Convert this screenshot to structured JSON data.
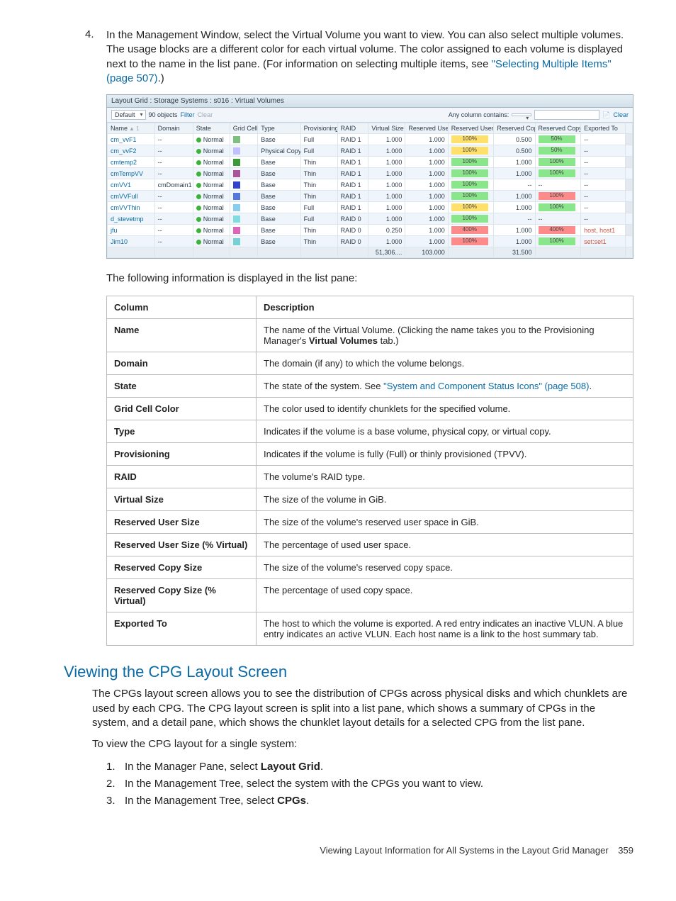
{
  "step4": {
    "number": "4.",
    "text_before_link": "In the Management Window, select the Virtual Volume you want to view. You can also select multiple volumes. The usage blocks are a different color for each virtual volume. The color assigned to each volume is displayed next to the name in the list pane. (For information on selecting multiple items, see ",
    "link_text": "\"Selecting Multiple Items\" (page 507)",
    "text_after_link": ".)"
  },
  "grid": {
    "title": "Layout Grid : Storage Systems : s016 : Virtual Volumes",
    "toolbar": {
      "view": "Default",
      "count_label": "90 objects",
      "filter_label": "Filter",
      "clear_left": "Clear",
      "any_col": "Any column contains:",
      "clear_right": "Clear"
    },
    "headers": [
      "Name",
      "Domain",
      "State",
      "Grid Cell Color",
      "Type",
      "Provisioning",
      "RAID",
      "Virtual Size (GiB)",
      "Reserved User Size (GiB)",
      "Reserved User Size (% Virtual)",
      "Reserved Copy Size (GiB)",
      "Reserved Copy Size (% Virtual)",
      "Exported To"
    ],
    "rows": [
      {
        "name": "cm_vvF1",
        "domain": "--",
        "state": "Normal",
        "swatch": "#7fbf7f",
        "type": "Base",
        "prov": "Full",
        "raid": "RAID 1",
        "vsize": "1.000",
        "rus": "1.000",
        "rupct": {
          "label": "100%",
          "color": "yellow"
        },
        "rcs": "0.500",
        "rcpct": {
          "label": "50%",
          "color": "green"
        },
        "exp": "--",
        "alt": false
      },
      {
        "name": "cm_vvF2",
        "domain": "--",
        "state": "Normal",
        "swatch": "#c0c0ff",
        "type": "Physical Copy",
        "prov": "Full",
        "raid": "RAID 1",
        "vsize": "1.000",
        "rus": "1.000",
        "rupct": {
          "label": "100%",
          "color": "yellow"
        },
        "rcs": "0.500",
        "rcpct": {
          "label": "50%",
          "color": "green"
        },
        "exp": "--",
        "alt": true
      },
      {
        "name": "cmtemp2",
        "domain": "--",
        "state": "Normal",
        "swatch": "#3b9b3b",
        "type": "Base",
        "prov": "Thin",
        "raid": "RAID 1",
        "vsize": "1.000",
        "rus": "1.000",
        "rupct": {
          "label": "100%",
          "color": "green"
        },
        "rcs": "1.000",
        "rcpct": {
          "label": "100%",
          "color": "green"
        },
        "exp": "--",
        "alt": false
      },
      {
        "name": "cmTempVV",
        "domain": "--",
        "state": "Normal",
        "swatch": "#aa5599",
        "type": "Base",
        "prov": "Thin",
        "raid": "RAID 1",
        "vsize": "1.000",
        "rus": "1.000",
        "rupct": {
          "label": "100%",
          "color": "green"
        },
        "rcs": "1.000",
        "rcpct": {
          "label": "100%",
          "color": "green"
        },
        "exp": "--",
        "alt": true
      },
      {
        "name": "cmVV1",
        "domain": "cmDomain1",
        "state": "Normal",
        "swatch": "#3344cc",
        "type": "Base",
        "prov": "Thin",
        "raid": "RAID 1",
        "vsize": "1.000",
        "rus": "1.000",
        "rupct": {
          "label": "100%",
          "color": "green"
        },
        "rcs": "--",
        "rcpct": {
          "label": "--",
          "color": "none"
        },
        "exp": "--",
        "alt": false
      },
      {
        "name": "cmVVFull",
        "domain": "--",
        "state": "Normal",
        "swatch": "#5577dd",
        "type": "Base",
        "prov": "Thin",
        "raid": "RAID 1",
        "vsize": "1.000",
        "rus": "1.000",
        "rupct": {
          "label": "100%",
          "color": "green"
        },
        "rcs": "1.000",
        "rcpct": {
          "label": "100%",
          "color": "red"
        },
        "exp": "--",
        "alt": true
      },
      {
        "name": "cmVVThin",
        "domain": "--",
        "state": "Normal",
        "swatch": "#88ccee",
        "type": "Base",
        "prov": "Full",
        "raid": "RAID 1",
        "vsize": "1.000",
        "rus": "1.000",
        "rupct": {
          "label": "100%",
          "color": "yellow"
        },
        "rcs": "1.000",
        "rcpct": {
          "label": "100%",
          "color": "green"
        },
        "exp": "--",
        "alt": false
      },
      {
        "name": "d_stevetmp",
        "domain": "--",
        "state": "Normal",
        "swatch": "#7fdde0",
        "type": "Base",
        "prov": "Full",
        "raid": "RAID 0",
        "vsize": "1.000",
        "rus": "1.000",
        "rupct": {
          "label": "100%",
          "color": "green"
        },
        "rcs": "--",
        "rcpct": {
          "label": "--",
          "color": "none"
        },
        "exp": "--",
        "alt": true
      },
      {
        "name": "jfu",
        "domain": "--",
        "state": "Normal",
        "swatch": "#dd66bb",
        "type": "Base",
        "prov": "Thin",
        "raid": "RAID 0",
        "vsize": "0.250",
        "rus": "1.000",
        "rupct": {
          "label": "400%",
          "color": "red"
        },
        "rcs": "1.000",
        "rcpct": {
          "label": "400%",
          "color": "red"
        },
        "exp": "host, host1",
        "alt": false
      },
      {
        "name": "Jim10",
        "domain": "--",
        "state": "Normal",
        "swatch": "#77d1d4",
        "type": "Base",
        "prov": "Thin",
        "raid": "RAID 0",
        "vsize": "1.000",
        "rus": "1.000",
        "rupct": {
          "label": "100%",
          "color": "red"
        },
        "rcs": "1.000",
        "rcpct": {
          "label": "100%",
          "color": "green"
        },
        "exp": "set:set1",
        "alt": true
      }
    ],
    "footer": {
      "vsize": "51,306....",
      "rus": "103.000",
      "rcs": "31.500"
    }
  },
  "para_after": "The following information is displayed in the list pane:",
  "desc_table": {
    "head": [
      "Column",
      "Description"
    ],
    "rows": [
      {
        "c": "Name",
        "plain_before": "The name of the Virtual Volume. (Clicking the name takes you to the Provisioning Manager's ",
        "bold": "Virtual Volumes",
        "plain_after": " tab.)"
      },
      {
        "c": "Domain",
        "d": "The domain (if any) to which the volume belongs."
      },
      {
        "c": "State",
        "plain_before": "The state of the system. See ",
        "link": "\"System and Component Status Icons\" (page 508)",
        "plain_after": "."
      },
      {
        "c": "Grid Cell Color",
        "d": "The color used to identify chunklets for the specified volume."
      },
      {
        "c": "Type",
        "d": "Indicates if the volume is a base volume, physical copy, or virtual copy."
      },
      {
        "c": "Provisioning",
        "d": "Indicates if the volume is fully (Full) or thinly provisioned (TPVV)."
      },
      {
        "c": "RAID",
        "d": "The volume's RAID type."
      },
      {
        "c": "Virtual Size",
        "d": "The size of the volume in GiB."
      },
      {
        "c": "Reserved User Size",
        "d": "The size of the volume's reserved user space in GiB."
      },
      {
        "c": "Reserved User Size (% Virtual)",
        "d": "The percentage of used user space."
      },
      {
        "c": "Reserved Copy Size",
        "d": "The size of the volume's reserved copy space."
      },
      {
        "c": "Reserved Copy Size (% Virtual)",
        "d": "The percentage of used copy space."
      },
      {
        "c": "Exported To",
        "d": "The host to which the volume is exported. A red entry indicates an inactive VLUN. A blue entry indicates an active VLUN. Each host name is a link to the host summary tab."
      }
    ]
  },
  "section": {
    "heading": "Viewing the CPG Layout Screen",
    "p1": "The CPGs layout screen allows you to see the distribution of CPGs across physical disks and which chunklets are used by each CPG. The CPG layout screen is split into a list pane, which shows a summary of CPGs in the system, and a detail pane, which shows the chunklet layout details for a selected CPG from the list pane.",
    "p2": "To view the CPG layout for a single system:",
    "steps": [
      {
        "before": "In the Manager Pane, select ",
        "bold": "Layout Grid",
        "after": "."
      },
      {
        "plain": "In the Management Tree, select the system with the CPGs you want to view."
      },
      {
        "before": "In the Management Tree, select ",
        "bold": "CPGs",
        "after": "."
      }
    ]
  },
  "footer": {
    "text": "Viewing Layout Information for All Systems in the Layout Grid Manager",
    "page": "359"
  }
}
